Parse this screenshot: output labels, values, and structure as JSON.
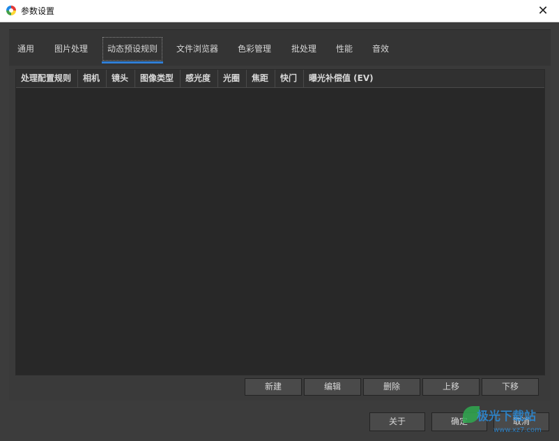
{
  "window": {
    "title": "参数设置",
    "close_label": "✕"
  },
  "tabs": [
    {
      "label": "通用"
    },
    {
      "label": "图片处理"
    },
    {
      "label": "动态预设规则",
      "active": true
    },
    {
      "label": "文件浏览器"
    },
    {
      "label": "色彩管理"
    },
    {
      "label": "批处理"
    },
    {
      "label": "性能"
    },
    {
      "label": "音效"
    }
  ],
  "table": {
    "columns": [
      {
        "label": "处理配置规则"
      },
      {
        "label": "相机"
      },
      {
        "label": "镜头"
      },
      {
        "label": "图像类型"
      },
      {
        "label": "感光度"
      },
      {
        "label": "光圈"
      },
      {
        "label": "焦距"
      },
      {
        "label": "快门"
      },
      {
        "label": "曝光补偿值 (EV)"
      }
    ],
    "rows": []
  },
  "actions": {
    "new": "新建",
    "edit": "编辑",
    "delete": "删除",
    "move_up": "上移",
    "move_down": "下移"
  },
  "footer": {
    "about": "关于",
    "ok": "确定",
    "cancel": "取消"
  },
  "watermark": {
    "text": "极光下载站",
    "url": "www.xz7.com"
  },
  "colors": {
    "accent": "#2f7fd6",
    "panel": "#3c3c3c",
    "table_bg": "#282828"
  }
}
